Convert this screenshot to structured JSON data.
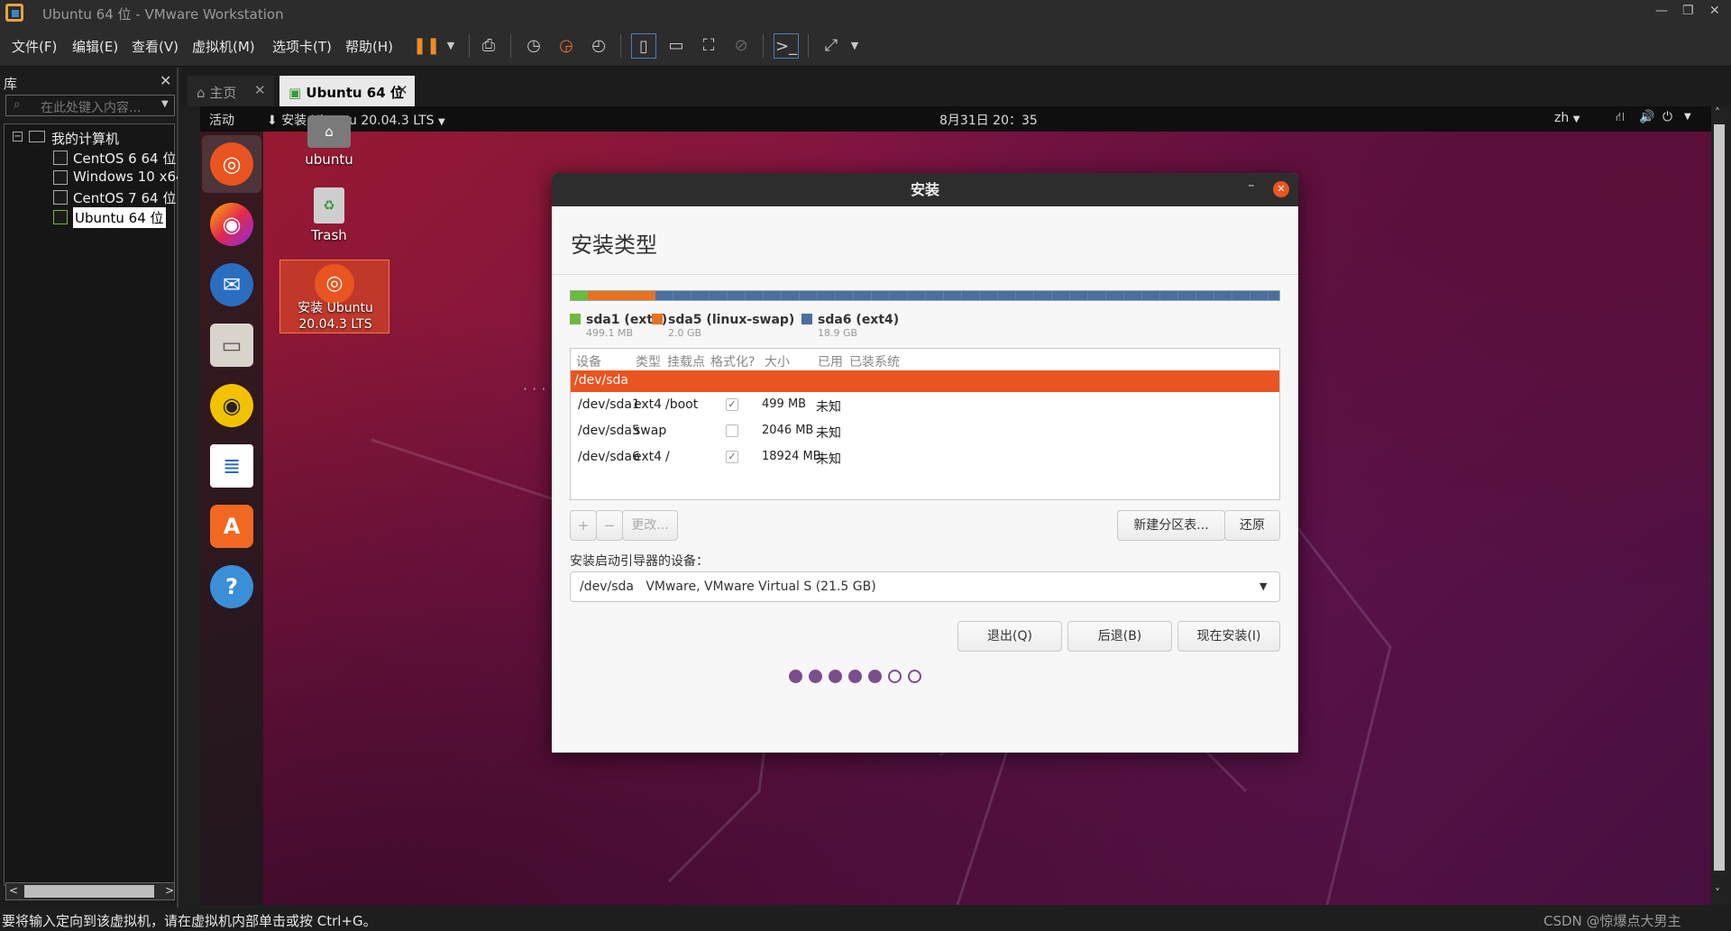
{
  "window": {
    "title": "Ubuntu 64 位 - VMware Workstation"
  },
  "menubar": {
    "items": [
      "文件(F)",
      "编辑(E)",
      "查看(V)",
      "虚拟机(M)",
      "选项卡(T)",
      "帮助(H)"
    ]
  },
  "library": {
    "title": "库",
    "search_placeholder": "在此处键入内容...",
    "root": "我的计算机",
    "vms": [
      "CentOS 6 64 位",
      "Windows 10 x64",
      "CentOS 7 64 位",
      "Ubuntu 64 位"
    ]
  },
  "tabs": [
    {
      "label": "主页"
    },
    {
      "label": "Ubuntu 64 位"
    }
  ],
  "ubuntu": {
    "activities": "活动",
    "app_menu": "安装 Ubuntu 20.04.3 LTS",
    "clock": "8月31日 20：35",
    "lang": "zh",
    "desktop": {
      "home": "ubuntu",
      "trash": "Trash",
      "installer": "安装 Ubuntu 20.04.3 LTS"
    }
  },
  "dialog": {
    "header": "安装",
    "title": "安装类型",
    "partitions": [
      {
        "name": "sda1 (ext4)",
        "size": "499.1 MB",
        "color": "#6cbb3c"
      },
      {
        "name": "sda5 (linux-swap)",
        "size": "2.0 GB",
        "color": "#e67322"
      },
      {
        "name": "sda6 (ext4)",
        "size": "18.9 GB",
        "color": "#4a6fa0"
      }
    ],
    "columns": [
      "设备",
      "类型",
      "挂载点",
      "格式化?",
      "大小",
      "已用",
      "已装系统"
    ],
    "disk_row": "/dev/sda",
    "rows": [
      {
        "device": "/dev/sda1",
        "type": "ext4",
        "mount": "/boot",
        "format": true,
        "size": "499 MB",
        "used": "未知"
      },
      {
        "device": "/dev/sda5",
        "type": "swap",
        "mount": "",
        "format": false,
        "size": "2046 MB",
        "used": "未知"
      },
      {
        "device": "/dev/sda6",
        "type": "ext4",
        "mount": "/",
        "format": true,
        "size": "18924 MB",
        "used": "未知"
      }
    ],
    "buttons": {
      "add": "+",
      "remove": "−",
      "change": "更改...",
      "new_table": "新建分区表...",
      "revert": "还原",
      "quit": "退出(Q)",
      "back": "后退(B)",
      "install": "现在安装(I)"
    },
    "bootloader_label": "安装启动引导器的设备：",
    "bootloader_device": "/dev/sda   VMware, VMware Virtual S (21.5 GB)",
    "progress": {
      "filled": 5,
      "total": 7
    }
  },
  "status": {
    "text": "要将输入定向到该虚拟机，请在虚拟机内部单击或按 Ctrl+G。",
    "watermark": "CSDN @惊爆点大男主"
  }
}
